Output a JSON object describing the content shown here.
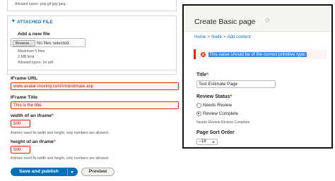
{
  "form": {
    "allowed_types_top": "Allowed types: png gif jpg jpeg.",
    "attached_file": {
      "heading": "ATTACHED FILE",
      "add_new_label": "Add a new file",
      "browse_label": "Browse...",
      "file_status": "No files selected.",
      "max_files": "Maximum 5 files.",
      "size_limit": "2 MB limit.",
      "allowed_types": "Allowed types: txt pdf."
    },
    "iframe_url": {
      "label": "IFrame URL",
      "value": "www.avatar-moving.com/rmtestimate.asp"
    },
    "iframe_title": {
      "label": "IFrame Title",
      "value": "This is the title"
    },
    "iframe_width": {
      "label": "width of an iframe",
      "required_mark": "*",
      "value": "500",
      "help": "iframes need fix width and height, only numbers are allowed."
    },
    "iframe_height": {
      "label": "height of an iframe",
      "required_mark": "*",
      "value": "500",
      "help": "iframes need fix width and height, only numbers are allowed."
    },
    "save_label": "Save and publish",
    "preview_label": "Preview"
  },
  "panel": {
    "title": "Create Basic page",
    "star_icon": "☆",
    "breadcrumb": [
      "Home",
      "Node",
      "Add content"
    ],
    "breadcrumb_separator": ">",
    "error_message": "This value should be of the correct primitive type.",
    "title_label": "Title",
    "title_required_mark": "*",
    "title_value": "Test Estimate Page",
    "review_status": {
      "label": "Review Status",
      "required_mark": "*",
      "options": [
        "Needs Review",
        "Review Complete"
      ],
      "selected": "Review Complete",
      "help": "Needs Review Review Complete"
    },
    "sort_order": {
      "label": "Page Sort Order",
      "value": "--18"
    }
  },
  "colors": {
    "error": "#e62600",
    "link": "#0074bd",
    "primary_button": "#0071b8",
    "selection": "#3d86e0"
  }
}
